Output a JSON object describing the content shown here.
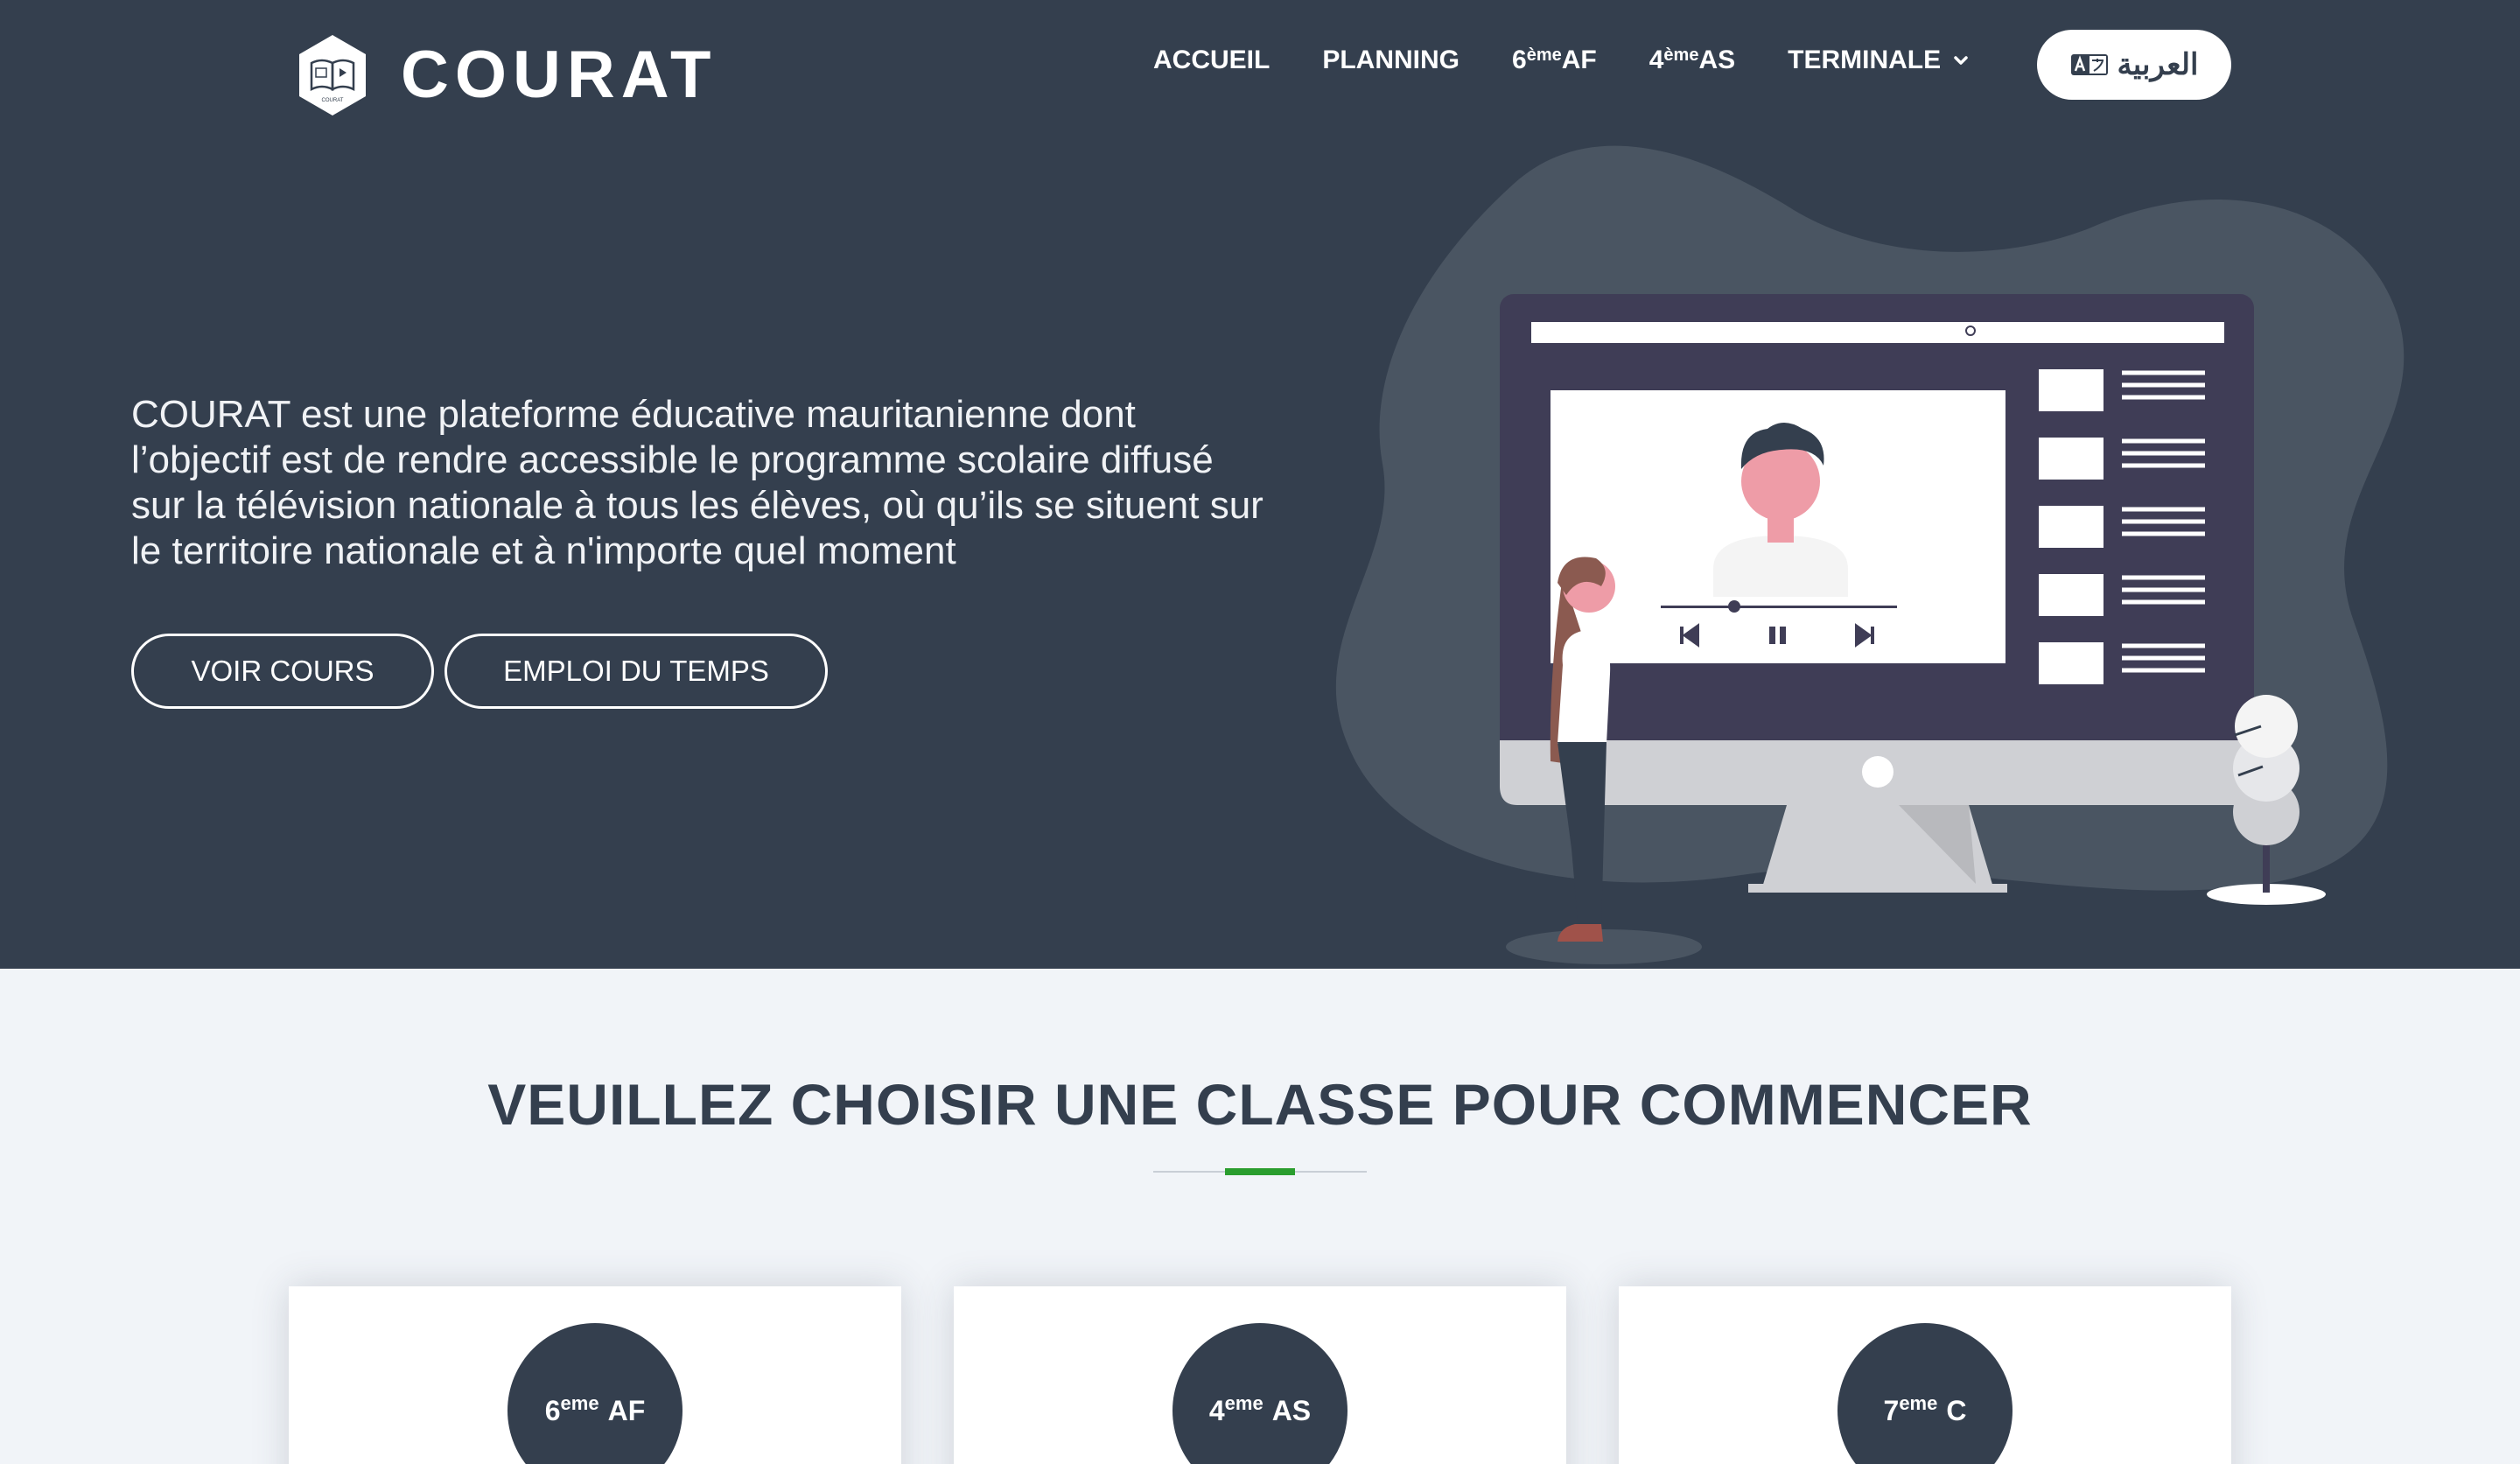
{
  "brand": {
    "name": "COURAT",
    "badge_text": "COURAT"
  },
  "nav": {
    "items": [
      {
        "label": "ACCUEIL"
      },
      {
        "label": "PLANNING"
      },
      {
        "num": "6",
        "sup": "ème",
        "suffix": "AF"
      },
      {
        "num": "4",
        "sup": "ème",
        "suffix": "AS"
      },
      {
        "label": "TERMINALE"
      }
    ],
    "language_label": "العربية"
  },
  "hero": {
    "description": "COURAT est une plateforme éducative mauritanienne dont l’objectif est de rendre accessible le programme scolaire diffusé sur la télévision nationale à tous les élèves, où qu’ils se situent sur le territoire nationale et à n'importe quel moment",
    "buttons": {
      "cours": "VOIR COURS",
      "emploi": "EMPLOI DU TEMPS"
    }
  },
  "section": {
    "title": "VEUILLEZ CHOISIR UNE CLASSE POUR COMMENCER"
  },
  "classes": [
    {
      "num": "6",
      "sup": "eme",
      "suffix": "AF"
    },
    {
      "num": "4",
      "sup": "eme",
      "suffix": "AS"
    },
    {
      "num": "7",
      "sup": "eme",
      "suffix": "C"
    }
  ],
  "colors": {
    "primary": "#343f4e",
    "accent": "#2a9d2e",
    "background": "#f1f4f8"
  },
  "icons": [
    "book-logo-icon",
    "chevron-down-icon",
    "translate-icon",
    "search-icon",
    "previous-icon",
    "pause-icon",
    "next-icon"
  ]
}
